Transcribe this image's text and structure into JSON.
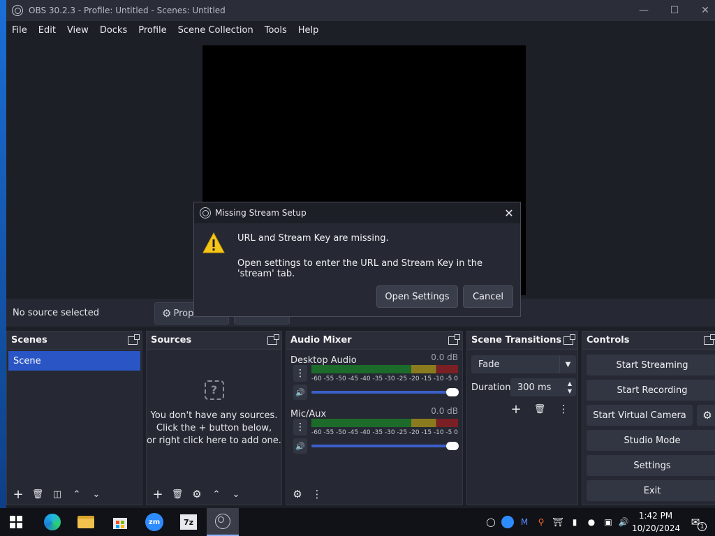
{
  "window": {
    "title": "OBS 30.2.3 - Profile: Untitled - Scenes: Untitled"
  },
  "menu": [
    "File",
    "Edit",
    "View",
    "Docks",
    "Profile",
    "Scene Collection",
    "Tools",
    "Help"
  ],
  "source_bar": {
    "status": "No source selected",
    "properties_label": "Prop"
  },
  "scenes": {
    "title": "Scenes",
    "items": [
      "Scene"
    ]
  },
  "sources": {
    "title": "Sources",
    "empty_line1": "You don't have any sources.",
    "empty_line2": "Click the + button below,",
    "empty_line3": "or right click here to add one."
  },
  "mixer": {
    "title": "Audio Mixer",
    "channels": [
      {
        "name": "Desktop Audio",
        "db": "0.0 dB"
      },
      {
        "name": "Mic/Aux",
        "db": "0.0 dB"
      }
    ],
    "scale": [
      "-60",
      "-55",
      "-50",
      "-45",
      "-40",
      "-35",
      "-30",
      "-25",
      "-20",
      "-15",
      "-10",
      "-5",
      "0"
    ]
  },
  "transitions": {
    "title": "Scene Transitions",
    "selected": "Fade",
    "duration_label": "Duration",
    "duration_value": "300 ms"
  },
  "controls": {
    "title": "Controls",
    "start_streaming": "Start Streaming",
    "start_recording": "Start Recording",
    "start_virtual_camera": "Start Virtual Camera",
    "studio_mode": "Studio Mode",
    "settings": "Settings",
    "exit": "Exit"
  },
  "dialog": {
    "title": "Missing Stream Setup",
    "message1": "URL and Stream Key are missing.",
    "message2": "Open settings to enter the URL and Stream Key in the 'stream' tab.",
    "open_settings": "Open Settings",
    "cancel": "Cancel"
  },
  "taskbar": {
    "zoom_label": "zm",
    "sevenzip_label": "7z",
    "time": "1:42 PM",
    "date": "10/20/2024",
    "notification_count": "1"
  }
}
